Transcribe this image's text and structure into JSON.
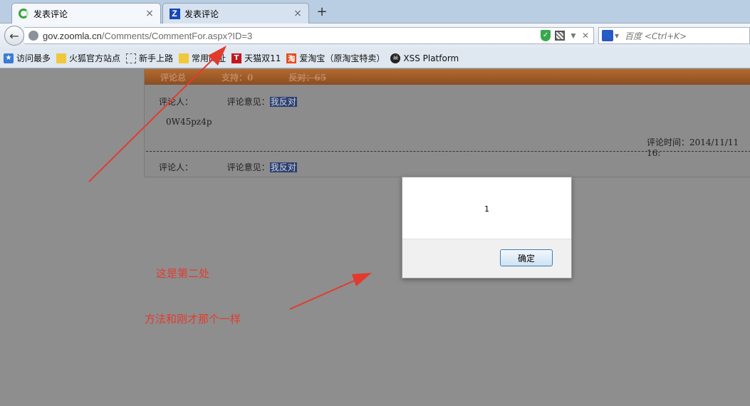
{
  "browser": {
    "tabs": [
      {
        "label": "发表评论",
        "active": true
      },
      {
        "label": "发表评论",
        "active": false
      }
    ],
    "url": {
      "host": "gov.zoomla.cn",
      "path": "/Comments/CommentFor.aspx?ID=3"
    },
    "search": {
      "placeholder": "百度 <Ctrl+K>"
    },
    "bookmarks": [
      {
        "label": "访问最多",
        "icon": "most-visited-icon"
      },
      {
        "label": "火狐官方站点",
        "icon": "folder-icon"
      },
      {
        "label": "新手上路",
        "icon": "blank-page-icon"
      },
      {
        "label": "常用网址",
        "icon": "folder-icon"
      },
      {
        "label": "天猫双11",
        "icon": "tmall-icon"
      },
      {
        "label": "爱淘宝（原淘宝特卖）",
        "icon": "taobao-icon"
      },
      {
        "label": "XSS Platform",
        "icon": "xss-icon"
      }
    ]
  },
  "comments": {
    "header": {
      "col1": "评论总",
      "support": "支持：0",
      "oppose": "反对：65"
    },
    "entries": [
      {
        "reviewer_label": "评论人：",
        "opinion_label": "评论意见：",
        "opinion": "我反对",
        "body": "0W45pz4p",
        "time_label": "评论时间：",
        "time": "2014/11/11 16:"
      },
      {
        "reviewer_label": "评论人：",
        "opinion_label": "评论意见：",
        "opinion": "我反对"
      }
    ]
  },
  "dialog": {
    "message": "1",
    "ok_label": "确定"
  },
  "annotations": {
    "note1": "这是第二处",
    "note2": "方法和刚才那个一样"
  },
  "colors": {
    "annotation": "#e23b2e",
    "header_bar": "#a4612a"
  }
}
